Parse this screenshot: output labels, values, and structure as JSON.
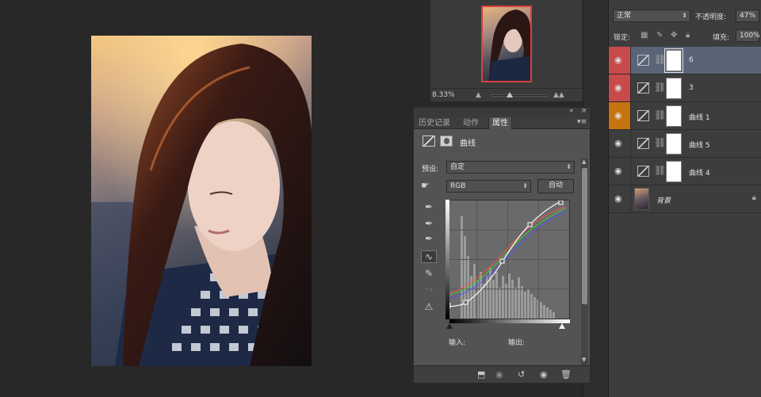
{
  "navigator": {
    "zoom": "8.33%",
    "icon_small": "mountain-small-icon",
    "icon_large": "mountain-large-icon"
  },
  "layers_panel": {
    "blend_mode": "正常",
    "opacity_label": "不透明度:",
    "opacity_value": "47%",
    "lock_label": "锁定:",
    "fill_label": "填充:",
    "fill_value": "100%",
    "layers": [
      {
        "name": "6",
        "eye": "eye-icon",
        "color_tag": "#c84b4b"
      },
      {
        "name": "3",
        "eye": "eye-icon",
        "color_tag": "#c84b4b"
      },
      {
        "name": "曲线 1",
        "eye": "eye-icon",
        "color_tag": "#c7730e"
      },
      {
        "name": "曲线 5",
        "eye": "eye-icon"
      },
      {
        "name": "曲线 4",
        "eye": "eye-icon"
      },
      {
        "name": "背景",
        "eye": "eye-icon"
      }
    ]
  },
  "properties_panel": {
    "tabs": [
      "历史记录",
      "动作",
      "属性"
    ],
    "active_tab": "属性",
    "title": "曲线",
    "preset_label": "预设:",
    "preset_value": "自定",
    "channel_value": "RGB",
    "auto_button": "自动",
    "input_label": "输入:",
    "output_label": "输出:",
    "curve_colors": {
      "rgb": "#ffffff",
      "red": "#ff5050",
      "green": "#3cc83c",
      "blue": "#5555ff"
    }
  }
}
